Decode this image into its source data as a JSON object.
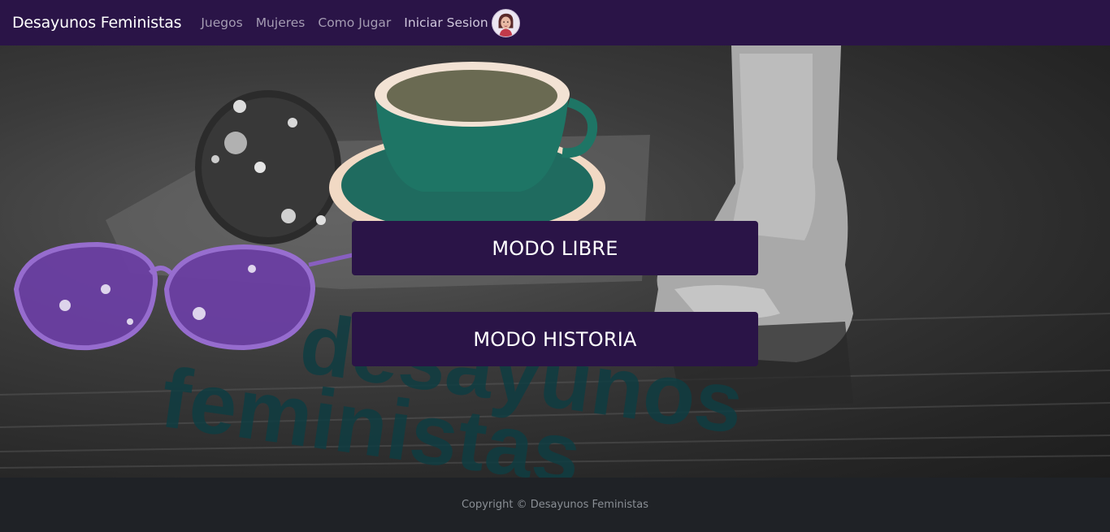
{
  "navbar": {
    "brand": "Desayunos Feministas",
    "links": [
      {
        "label": "Juegos"
      },
      {
        "label": "Mujeres"
      },
      {
        "label": "Como Jugar"
      }
    ],
    "login_label": "Iniciar Sesion",
    "avatar_icon": "user-avatar-icon"
  },
  "hero": {
    "background_text_line1": "desayunos",
    "background_text_line2": "feministas",
    "buttons": {
      "libre": "MODO LIBRE",
      "historia": "MODO HISTORIA"
    }
  },
  "footer": {
    "copyright": "Copyright © Desayunos Feministas"
  },
  "colors": {
    "navbar_bg": "#2a1447",
    "button_bg": "#2a1447",
    "footer_bg": "#1f2226",
    "teal_text": "#0f3d42",
    "glasses_purple": "#7a4bb0"
  }
}
